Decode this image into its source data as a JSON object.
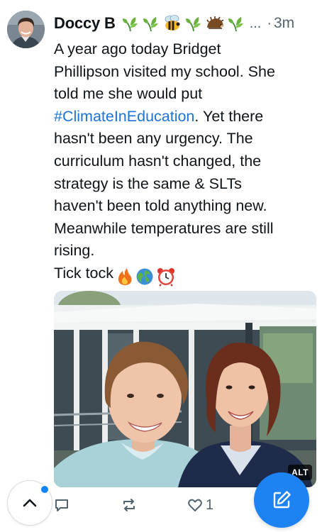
{
  "post": {
    "author": {
      "display_name": "Doccy B",
      "name_emoji_icons": [
        "herb-icon",
        "herb-icon",
        "bee-icon",
        "herb-icon",
        "hedgehog-icon",
        "herb-icon"
      ],
      "ellipsis": "...",
      "avatar_icon": "profile-photo"
    },
    "separator": "·",
    "time_ago": "3m",
    "body": {
      "line1": "A year ago today Bridget",
      "line2": "Phillipson visited my school. She",
      "line3": "told me she would put",
      "hashtag": "#ClimateInEducation",
      "line4_rest": ". Yet there",
      "line5": "hasn't been any urgency. The",
      "line6": "curriculum hasn't changed, the",
      "line7": "strategy is the same & SLTs",
      "line8": "haven't been told anything new.",
      "line9": "Meanwhile temperatures are still",
      "line10": "rising.",
      "line11": "Tick tock",
      "end_emoji_icons": [
        "fire-icon",
        "globe-icon",
        "alarm-clock-icon"
      ]
    },
    "image": {
      "alt_badge": "ALT"
    },
    "actions": {
      "reply_count": "",
      "repost_count": "",
      "like_count": "1"
    }
  },
  "colors": {
    "link": "#1d74d8",
    "compose": "#1d83f3",
    "notification_dot": "#1083fe",
    "muted_text": "#536471"
  }
}
